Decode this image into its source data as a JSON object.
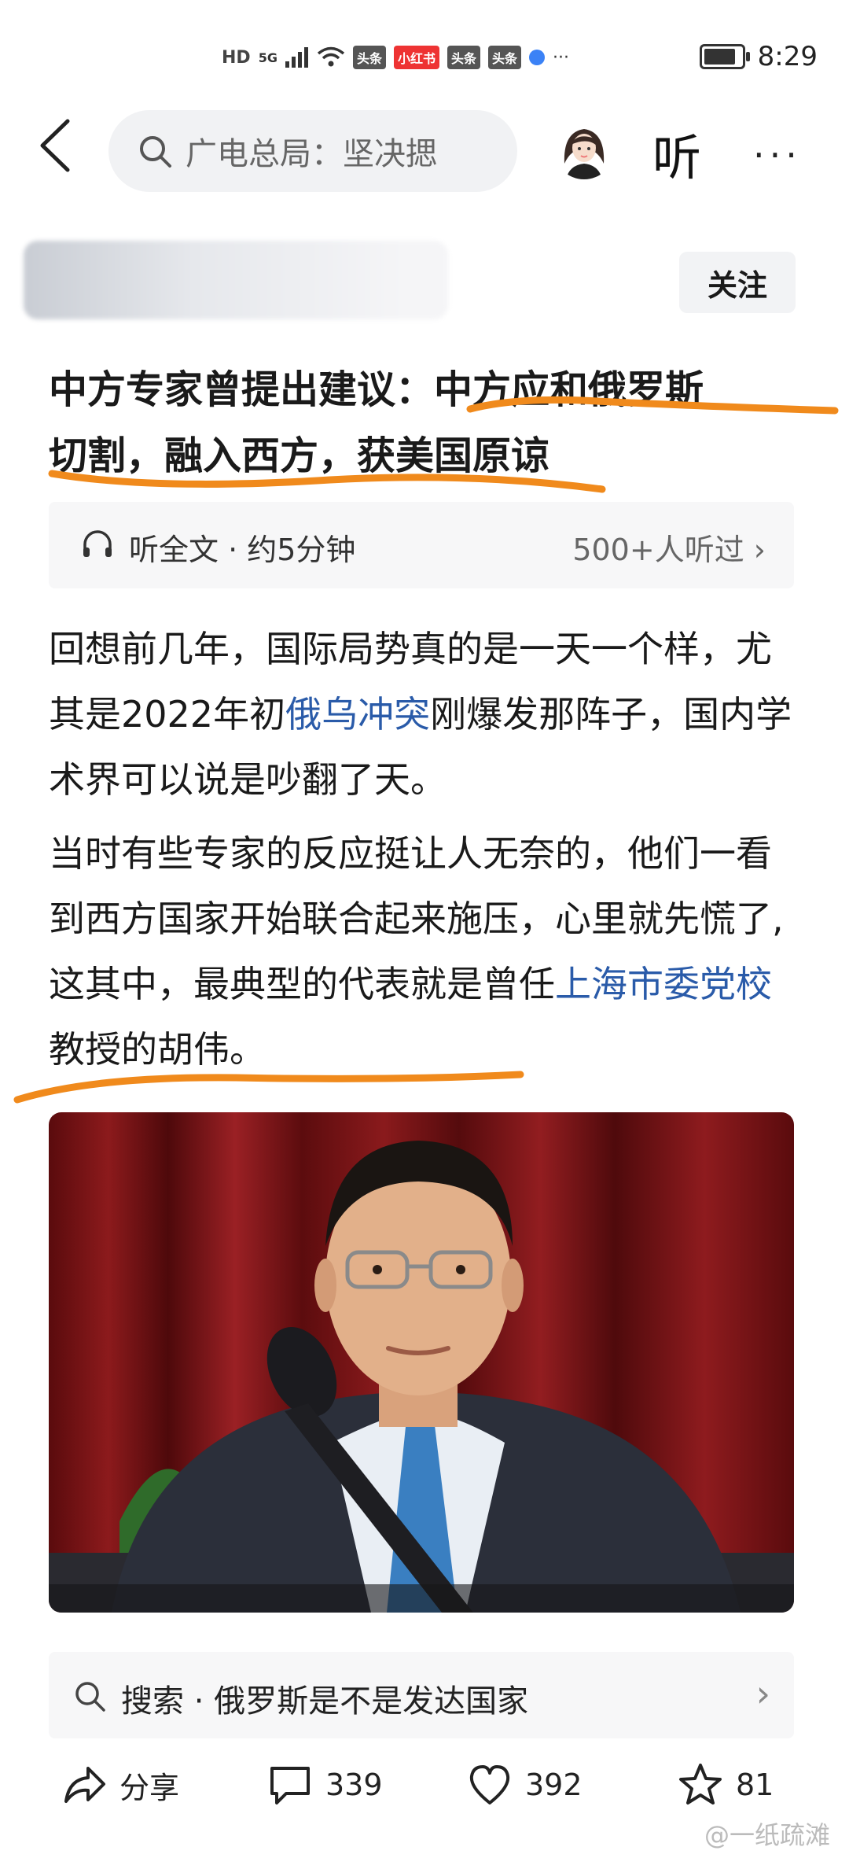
{
  "status_bar": {
    "left_indicators": [
      "HD",
      "5G",
      "头条",
      "小红书",
      "头条",
      "头条",
      "···"
    ],
    "time": "8:29"
  },
  "header": {
    "search_placeholder": "广电总局：坚决揌",
    "listen_label": "听",
    "more_label": "···"
  },
  "author": {
    "follow_label": "关注"
  },
  "article": {
    "title_line1": "中方专家曾提出建议：中方应和俄罗斯",
    "title_line2": "切割，融入西方，获美国原谅",
    "listen_bar": {
      "label": "听全文 · 约5分钟",
      "count": "500+人听过"
    },
    "p1_a": "回想前几年，国际局势真的是一天一个样，尤其是2022年初",
    "p1_link": "俄乌冲突",
    "p1_b": "刚爆发那阵子，国内学术界可以说是吵翻了天。",
    "p2_a": "当时有些专家的反应挺让人无奈的，他们一看到西方国家开始联合起来施压，心里就先慌了,这其中，最典型的代表就是曾任",
    "p2_link": "上海市委党校",
    "p2_b": "教授的胡伟。"
  },
  "related_search": {
    "label": "搜索 · 俄罗斯是不是发达国家"
  },
  "actions": {
    "share_label": "分享",
    "comment_count": "339",
    "like_count": "392",
    "favorite_count": "81"
  },
  "watermark": "@一纸疏滩",
  "colors": {
    "link": "#2a5ba9",
    "underline": "#f08a1c"
  }
}
